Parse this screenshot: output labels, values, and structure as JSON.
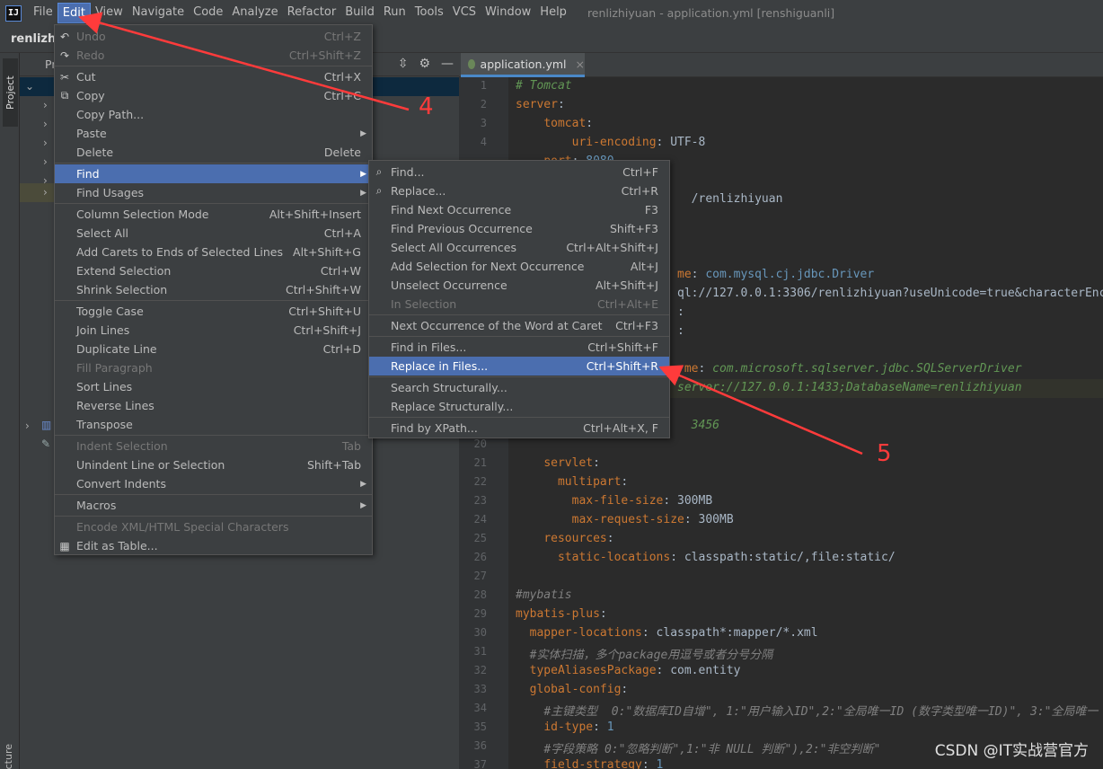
{
  "menubar": {
    "logo": "IJ",
    "items": [
      "File",
      "Edit",
      "View",
      "Navigate",
      "Code",
      "Analyze",
      "Refactor",
      "Build",
      "Run",
      "Tools",
      "VCS",
      "Window",
      "Help"
    ],
    "title": "renlizhiyuan - application.yml [renshiguanli]"
  },
  "navbar": {
    "crumb": "renlizhiy"
  },
  "left_strip": {
    "project": "Project",
    "structure": "cture"
  },
  "project_panel": {
    "header": "Pr"
  },
  "editor": {
    "tab_label": "application.yml",
    "line_numbers": [
      "1",
      "2",
      "3",
      "4",
      "",
      "",
      "",
      "",
      "",
      "",
      "",
      "",
      "",
      "",
      "",
      "",
      "",
      "",
      "",
      "20",
      "21",
      "22",
      "23",
      "24",
      "25",
      "26",
      "27",
      "28",
      "29",
      "30",
      "31",
      "32",
      "33",
      "34",
      "35",
      "36",
      "37"
    ],
    "lines": [
      {
        "parts": [
          [
            "c",
            "# Tomcat"
          ]
        ]
      },
      {
        "parts": [
          [
            "k",
            "server"
          ],
          [
            "v",
            ":"
          ]
        ]
      },
      {
        "parts": [
          [
            "v",
            "    "
          ],
          [
            "k",
            "tomcat"
          ],
          [
            "v",
            ":"
          ]
        ]
      },
      {
        "parts": [
          [
            "v",
            "        "
          ],
          [
            "k",
            "uri-encoding"
          ],
          [
            "v",
            ": UTF-8"
          ]
        ]
      },
      {
        "parts": [
          [
            "v",
            "    "
          ],
          [
            "k",
            "port"
          ],
          [
            "v",
            ": "
          ],
          [
            "n",
            "8080"
          ]
        ]
      },
      {
        "parts": []
      },
      {
        "parts": [
          [
            "v",
            "                         /renlizhiyuan"
          ]
        ]
      },
      {
        "parts": []
      },
      {
        "parts": []
      },
      {
        "parts": []
      },
      {
        "parts": [
          [
            "k",
            "                       me"
          ],
          [
            "v",
            ": "
          ],
          [
            "n",
            "com.mysql.cj.jdbc.Driver"
          ]
        ]
      },
      {
        "parts": [
          [
            "v",
            "                       ql://127.0.0.1:3306/renlizhiyuan?useUnicode=true&characterEnc"
          ]
        ]
      },
      {
        "parts": [
          [
            "v",
            "                       :"
          ]
        ]
      },
      {
        "parts": [
          [
            "v",
            "                       :"
          ]
        ]
      },
      {
        "parts": []
      },
      {
        "parts": [
          [
            "k",
            "                        me"
          ],
          [
            "v",
            ": "
          ],
          [
            "c",
            "com.microsoft.sqlserver.jdbc.SQLServerDriver"
          ]
        ]
      },
      {
        "parts": [
          [
            "c",
            "                       server://127.0.0.1:1433;DatabaseName=renlizhiyuan"
          ]
        ]
      },
      {
        "parts": []
      },
      {
        "parts": [
          [
            "c",
            "                         3456"
          ]
        ]
      },
      {
        "parts": []
      },
      {
        "parts": [
          [
            "v",
            "    "
          ],
          [
            "k",
            "servlet"
          ],
          [
            "v",
            ":"
          ]
        ]
      },
      {
        "parts": [
          [
            "v",
            "      "
          ],
          [
            "k",
            "multipart"
          ],
          [
            "v",
            ":"
          ]
        ]
      },
      {
        "parts": [
          [
            "v",
            "        "
          ],
          [
            "k",
            "max-file-size"
          ],
          [
            "v",
            ": 300MB"
          ]
        ]
      },
      {
        "parts": [
          [
            "v",
            "        "
          ],
          [
            "k",
            "max-request-size"
          ],
          [
            "v",
            ": 300MB"
          ]
        ]
      },
      {
        "parts": [
          [
            "v",
            "    "
          ],
          [
            "k",
            "resources"
          ],
          [
            "v",
            ":"
          ]
        ]
      },
      {
        "parts": [
          [
            "v",
            "      "
          ],
          [
            "k",
            "static-locations"
          ],
          [
            "v",
            ": classpath:static/,file:static/"
          ]
        ]
      },
      {
        "parts": []
      },
      {
        "parts": [
          [
            "cm",
            "#mybatis"
          ]
        ]
      },
      {
        "parts": [
          [
            "k",
            "mybatis-plus"
          ],
          [
            "v",
            ":"
          ]
        ]
      },
      {
        "parts": [
          [
            "v",
            "  "
          ],
          [
            "k",
            "mapper-locations"
          ],
          [
            "v",
            ": classpath*:mapper/*.xml"
          ]
        ]
      },
      {
        "parts": [
          [
            "v",
            "  "
          ],
          [
            "cm",
            "#实体扫描，多个package用逗号或者分号分隔"
          ]
        ]
      },
      {
        "parts": [
          [
            "v",
            "  "
          ],
          [
            "k",
            "typeAliasesPackage"
          ],
          [
            "v",
            ": com.entity"
          ]
        ]
      },
      {
        "parts": [
          [
            "v",
            "  "
          ],
          [
            "k",
            "global-config"
          ],
          [
            "v",
            ":"
          ]
        ]
      },
      {
        "parts": [
          [
            "v",
            "    "
          ],
          [
            "cm",
            "#主键类型  0:\"数据库ID自增\", 1:\"用户输入ID\",2:\"全局唯一ID (数字类型唯一ID)\", 3:\"全局唯一"
          ]
        ]
      },
      {
        "parts": [
          [
            "v",
            "    "
          ],
          [
            "k",
            "id-type"
          ],
          [
            "v",
            ": "
          ],
          [
            "n",
            "1"
          ]
        ]
      },
      {
        "parts": [
          [
            "v",
            "    "
          ],
          [
            "cm",
            "#字段策略 0:\"忽略判断\",1:\"非 NULL 判断\"),2:\"非空判断\""
          ]
        ]
      },
      {
        "parts": [
          [
            "v",
            "    "
          ],
          [
            "k",
            "field-strategy"
          ],
          [
            "v",
            ": "
          ],
          [
            "n",
            "1"
          ]
        ]
      }
    ]
  },
  "edit_menu": {
    "items": [
      {
        "label": "Undo",
        "shortcut": "Ctrl+Z",
        "icon": "undo-icon",
        "glyph": "↶",
        "disabled": true
      },
      {
        "label": "Redo",
        "shortcut": "Ctrl+Shift+Z",
        "icon": "redo-icon",
        "glyph": "↷",
        "disabled": true
      },
      {
        "sep": true
      },
      {
        "label": "Cut",
        "shortcut": "Ctrl+X",
        "icon": "cut-icon",
        "glyph": "✂"
      },
      {
        "label": "Copy",
        "shortcut": "Ctrl+C",
        "icon": "copy-icon",
        "glyph": "⧉"
      },
      {
        "label": "Copy Path...",
        "shortcut": ""
      },
      {
        "label": "Paste",
        "shortcut": "",
        "submenu": true
      },
      {
        "label": "Delete",
        "shortcut": "Delete"
      },
      {
        "sep": true
      },
      {
        "label": "Find",
        "shortcut": "",
        "submenu": true,
        "selected": true
      },
      {
        "label": "Find Usages",
        "shortcut": "",
        "submenu": true
      },
      {
        "sep": true
      },
      {
        "label": "Column Selection Mode",
        "shortcut": "Alt+Shift+Insert"
      },
      {
        "label": "Select All",
        "shortcut": "Ctrl+A"
      },
      {
        "label": "Add Carets to Ends of Selected Lines",
        "shortcut": "Alt+Shift+G"
      },
      {
        "label": "Extend Selection",
        "shortcut": "Ctrl+W"
      },
      {
        "label": "Shrink Selection",
        "shortcut": "Ctrl+Shift+W"
      },
      {
        "sep": true
      },
      {
        "label": "Toggle Case",
        "shortcut": "Ctrl+Shift+U"
      },
      {
        "label": "Join Lines",
        "shortcut": "Ctrl+Shift+J"
      },
      {
        "label": "Duplicate Line",
        "shortcut": "Ctrl+D"
      },
      {
        "label": "Fill Paragraph",
        "shortcut": "",
        "disabled": true
      },
      {
        "label": "Sort Lines",
        "shortcut": ""
      },
      {
        "label": "Reverse Lines",
        "shortcut": ""
      },
      {
        "label": "Transpose",
        "shortcut": ""
      },
      {
        "sep": true
      },
      {
        "label": "Indent Selection",
        "shortcut": "Tab",
        "disabled": true
      },
      {
        "label": "Unindent Line or Selection",
        "shortcut": "Shift+Tab"
      },
      {
        "label": "Convert Indents",
        "shortcut": "",
        "submenu": true
      },
      {
        "sep": true
      },
      {
        "label": "Macros",
        "shortcut": "",
        "submenu": true
      },
      {
        "sep": true
      },
      {
        "label": "Encode XML/HTML Special Characters",
        "shortcut": "",
        "disabled": true
      },
      {
        "label": "Edit as Table...",
        "shortcut": "",
        "icon": "table-icon",
        "glyph": "▦"
      }
    ]
  },
  "find_menu": {
    "items": [
      {
        "label": "Find...",
        "shortcut": "Ctrl+F",
        "icon": "search-icon",
        "glyph": "⌕"
      },
      {
        "label": "Replace...",
        "shortcut": "Ctrl+R",
        "icon": "replace-icon",
        "glyph": "⌕"
      },
      {
        "label": "Find Next Occurrence",
        "shortcut": "F3"
      },
      {
        "label": "Find Previous Occurrence",
        "shortcut": "Shift+F3"
      },
      {
        "label": "Select All Occurrences",
        "shortcut": "Ctrl+Alt+Shift+J"
      },
      {
        "label": "Add Selection for Next Occurrence",
        "shortcut": "Alt+J"
      },
      {
        "label": "Unselect Occurrence",
        "shortcut": "Alt+Shift+J"
      },
      {
        "label": "In Selection",
        "shortcut": "Ctrl+Alt+E",
        "disabled": true
      },
      {
        "sep": true
      },
      {
        "label": "Next Occurrence of the Word at Caret",
        "shortcut": "Ctrl+F3"
      },
      {
        "sep": true
      },
      {
        "label": "Find in Files...",
        "shortcut": "Ctrl+Shift+F"
      },
      {
        "label": "Replace in Files...",
        "shortcut": "Ctrl+Shift+R",
        "selected": true
      },
      {
        "sep": true
      },
      {
        "label": "Search Structurally...",
        "shortcut": ""
      },
      {
        "label": "Replace Structurally...",
        "shortcut": ""
      },
      {
        "sep": true
      },
      {
        "label": "Find by XPath...",
        "shortcut": "Ctrl+Alt+X, F"
      }
    ]
  },
  "annotations": {
    "step4": "4",
    "step5": "5",
    "color": "#ff3b3b"
  },
  "watermark": "CSDN @IT实战营官方"
}
